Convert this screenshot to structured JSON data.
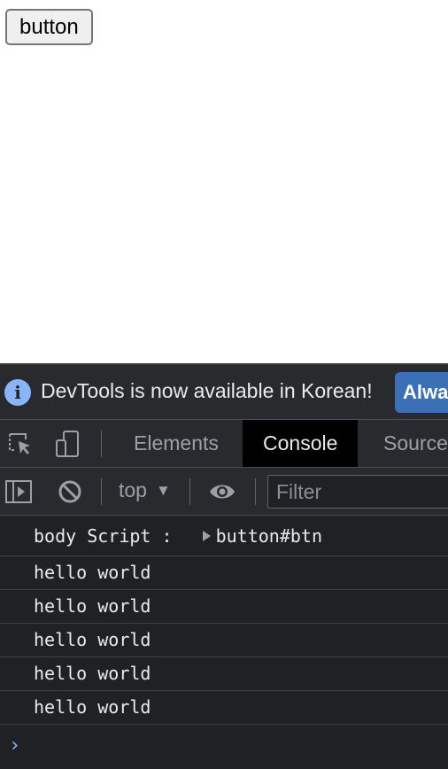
{
  "page": {
    "button_label": "button"
  },
  "devtools": {
    "infobar": {
      "message": "DevTools is now available in Korean!",
      "action_label": "Always match Chrome's language"
    },
    "tabs": [
      {
        "label": "Elements",
        "active": false
      },
      {
        "label": "Console",
        "active": true
      },
      {
        "label": "Sources",
        "active": false
      }
    ],
    "toolbar": {
      "context": "top",
      "filter_placeholder": "Filter"
    },
    "console": {
      "first": {
        "label": "body Script :",
        "object": "button#btn"
      },
      "logs": [
        "hello world",
        "hello world",
        "hello world",
        "hello world",
        "hello world"
      ],
      "prompt": "›"
    }
  }
}
